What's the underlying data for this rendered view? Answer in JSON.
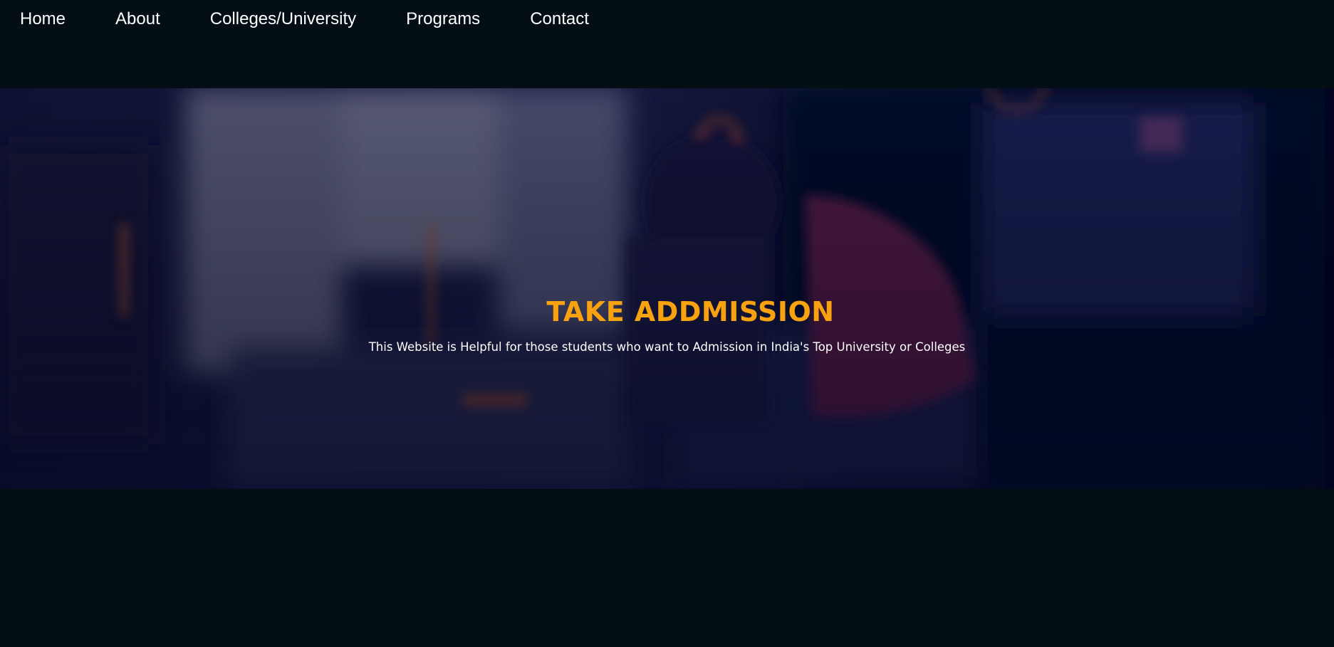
{
  "nav": {
    "items": [
      {
        "label": "Home"
      },
      {
        "label": "About"
      },
      {
        "label": "Colleges/University"
      },
      {
        "label": "Programs"
      },
      {
        "label": "Contact"
      }
    ]
  },
  "hero": {
    "title": "TAKE ADDMISSION",
    "subtitle": "This Website is Helpful for those students who want to Admission in India's Top University or Colleges"
  },
  "colors": {
    "page_background": "#040e15",
    "hero_title": "#f7a20e",
    "nav_text": "#ffffff",
    "hero_overlay": "#0b0d2a"
  }
}
